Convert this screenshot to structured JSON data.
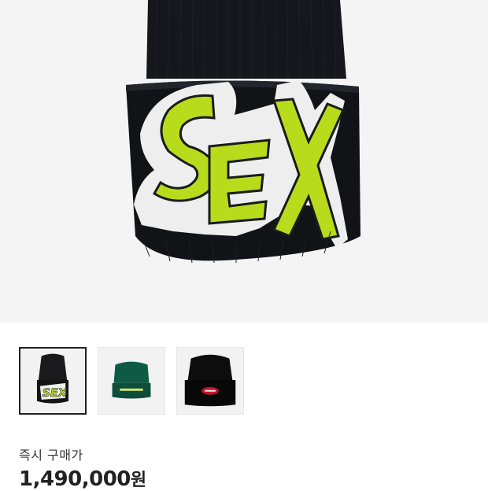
{
  "hero": {
    "image_name": "beanie-main-photo",
    "logo_text": "SEX",
    "colors": {
      "knit": "#14161b",
      "lettering": "#b8dc1c",
      "patch": "#f1f1f1"
    }
  },
  "thumbnails": [
    {
      "label": "",
      "selected": true,
      "color": "#1a1a1d",
      "logo": "SEX"
    },
    {
      "label": "",
      "selected": false,
      "color": "#0f5a45",
      "logo": ""
    },
    {
      "label": "",
      "selected": false,
      "color": "#0d0d0d",
      "logo": ""
    }
  ],
  "purchase": {
    "label": "즉시 구매가",
    "price": "1,490,000",
    "unit": "원"
  }
}
